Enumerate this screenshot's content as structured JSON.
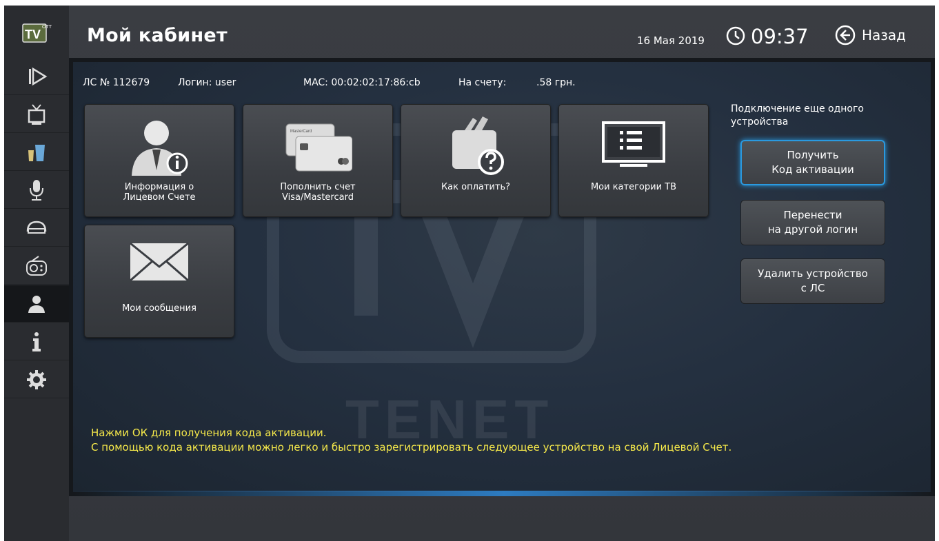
{
  "header": {
    "title": "Мой кабинет",
    "date": "16 Мая 2019",
    "time": "09:37",
    "back_label": "Назад"
  },
  "logo": {
    "text": "TV",
    "badge": "OTT"
  },
  "sidebar": {
    "items": [
      {
        "icon": "play-icon",
        "active": false
      },
      {
        "icon": "tv-icon",
        "active": false
      },
      {
        "icon": "drinks-icon",
        "active": false
      },
      {
        "icon": "microphone-icon",
        "active": false
      },
      {
        "icon": "media-club-icon",
        "active": false
      },
      {
        "icon": "radio-icon",
        "active": false
      },
      {
        "icon": "user-icon",
        "active": true
      },
      {
        "icon": "info-icon",
        "active": false
      },
      {
        "icon": "gear-icon",
        "active": false
      }
    ]
  },
  "account": {
    "ls": "ЛС № 112679",
    "login": "Логин: user",
    "mac": "MAC: 00:02:02:17:86:cb",
    "balance_label": "На счету:",
    "balance_value": ".58 грн."
  },
  "tiles": [
    {
      "line1": "Информация о",
      "line2": "Лицевом Счете",
      "icon": "user-info-icon"
    },
    {
      "line1": "Пополнить счет",
      "line2": "Visa/Mastercard",
      "icon": "credit-card-icon"
    },
    {
      "line1": "Как оплатить?",
      "line2": "",
      "icon": "wallet-question-icon"
    },
    {
      "line1": "Мои категории ТВ",
      "line2": "",
      "icon": "tv-list-icon"
    },
    {
      "line1": "Мои сообщения",
      "line2": "",
      "icon": "envelope-icon"
    }
  ],
  "side_actions": {
    "label": "Подключение еще одного устройства",
    "buttons": [
      {
        "line1": "Получить",
        "line2": "Код активации",
        "focused": true
      },
      {
        "line1": "Перенести",
        "line2": "на другой логин",
        "focused": false
      },
      {
        "line1": "Удалить устройство",
        "line2": "с ЛС",
        "focused": false
      }
    ]
  },
  "hint": {
    "line1": "Нажми ОК для получения кода активации.",
    "line2": "С помощью кода активации можно легко и быстро зарегистрировать следующее устройство на свой Лицевой Счет."
  },
  "watermark": "TENET",
  "colors": {
    "accent": "#2a9ae0",
    "hint": "#f6e94a"
  }
}
